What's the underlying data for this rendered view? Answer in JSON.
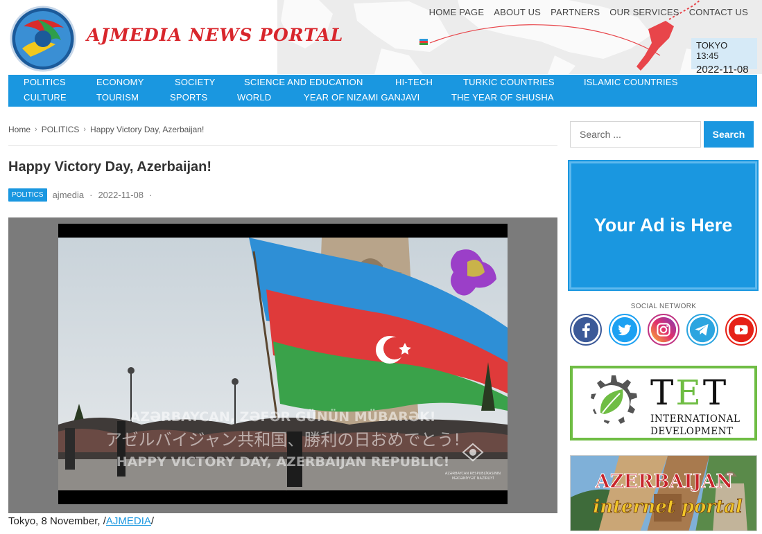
{
  "header": {
    "site_title": "AJMEDIA NEWS PORTAL",
    "top_nav": [
      "HOME PAGE",
      "ABOUT US",
      "PARTNERS",
      "OUR SERVICES",
      "CONTACT US"
    ],
    "tokyo_time": "TOKYO 13:45",
    "tokyo_date": "2022-11-08"
  },
  "categories": {
    "row1": [
      "POLITICS",
      "ECONOMY",
      "SOCIETY",
      "SCIENCE AND EDUCATION",
      "HI-TECH",
      "TURKIC COUNTRIES",
      "ISLAMIC COUNTRIES"
    ],
    "row2": [
      "CULTURE",
      "TOURISM",
      "SPORTS",
      "WORLD",
      "YEAR OF NIZAMI GANJAVI",
      "THE YEAR OF SHUSHA"
    ]
  },
  "breadcrumb": [
    "Home",
    "POLITICS",
    "Happy Victory Day, Azerbaijan!"
  ],
  "post": {
    "title": "Happy Victory Day, Azerbaijan!",
    "category": "POLITICS",
    "author": "ajmedia",
    "date": "2022-11-08",
    "caption_prefix": "Tokyo, 8 November, /",
    "caption_link": "AJMEDIA",
    "caption_suffix": "/"
  },
  "video": {
    "overlay_az": "AZƏRBAYCAN, ZƏFƏR GÜNÜN MÜBARƏK!",
    "overlay_jp": "アゼルバイジャン共和国、勝利の日おめでとう!",
    "overlay_en": "HAPPY VICTORY DAY, AZERBAIJAN REPUBLIC!",
    "watermark_line1": "AZƏRBAYCAN RESPUBLİKASININ",
    "watermark_line2": "MƏDƏNİYYƏT NAZİRLİYİ"
  },
  "sidebar": {
    "search_placeholder": "Search ...",
    "search_button": "Search",
    "ad_text": "Your Ad is Here",
    "social_title": "SOCIAL NETWORK",
    "tet_letters": [
      "T",
      "E",
      "T"
    ],
    "tet_line1": "INTERNATIONAL",
    "tet_line2": "DEVELOPMENT",
    "aip_line1": "AZERBAIJAN",
    "aip_line2": "internet portal"
  },
  "colors": {
    "brand_blue": "#1a97e0",
    "title_red": "#d8262c",
    "tet_green": "#6fbd44"
  },
  "icons": [
    "facebook-icon",
    "twitter-icon",
    "instagram-icon",
    "telegram-icon",
    "youtube-icon"
  ]
}
